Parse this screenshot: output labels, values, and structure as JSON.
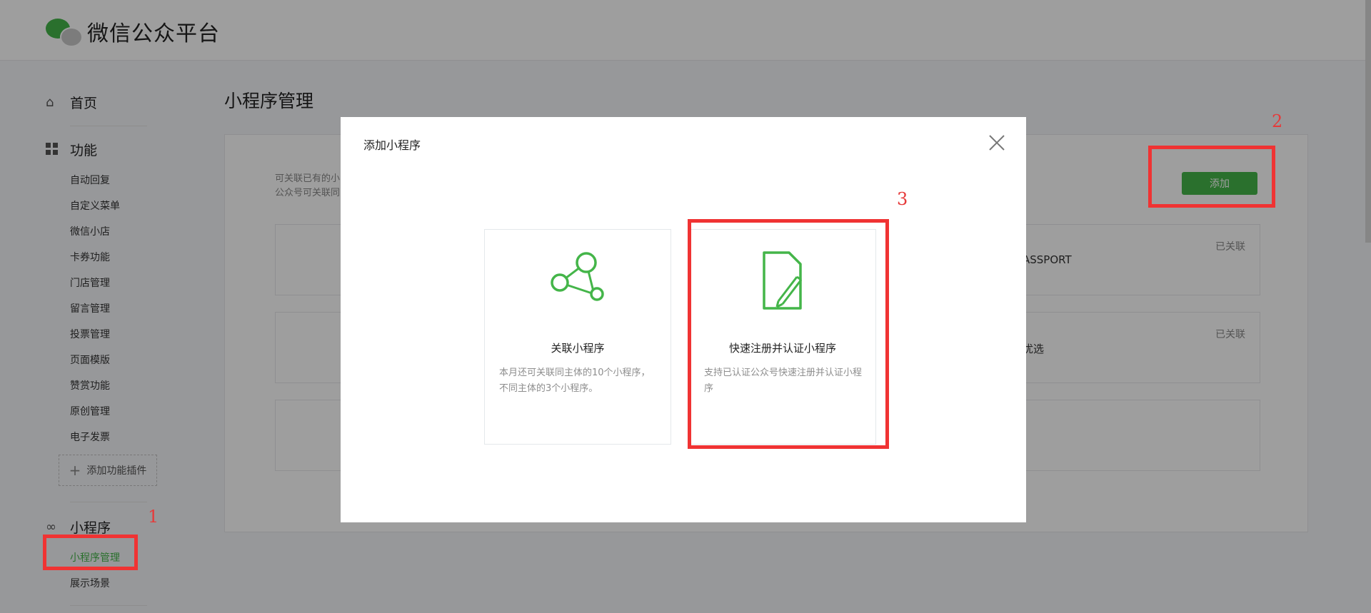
{
  "header": {
    "logo_text": "微信公众平台"
  },
  "sidebar": {
    "home": "首页",
    "functions": "功能",
    "items": [
      "自动回复",
      "自定义菜单",
      "微信小店",
      "卡券功能",
      "门店管理",
      "留言管理",
      "投票管理",
      "页面模版",
      "赞赏功能",
      "原创管理",
      "电子发票"
    ],
    "add_plugin": "添加功能插件",
    "miniprogram": "小程序",
    "mp_items": [
      "小程序管理",
      "展示场景"
    ]
  },
  "main": {
    "title": "小程序管理",
    "desc_line1": "可关联已有的小",
    "desc_line2": "公众号可关联同",
    "add_button": "添加",
    "cards": [
      {
        "name": "ASSPORT",
        "status": "已关联"
      },
      {
        "name": "优选",
        "status": "已关联"
      }
    ]
  },
  "modal": {
    "title": "添加小程序",
    "options": [
      {
        "title": "关联小程序",
        "desc": "本月还可关联同主体的10个小程序，不同主体的3个小程序。"
      },
      {
        "title": "快速注册并认证小程序",
        "desc": "支持已认证公众号快速注册并认证小程序"
      }
    ]
  },
  "annotations": [
    "1",
    "2",
    "3"
  ],
  "colors": {
    "accent": "#44b549",
    "annotation": "#f03333"
  }
}
